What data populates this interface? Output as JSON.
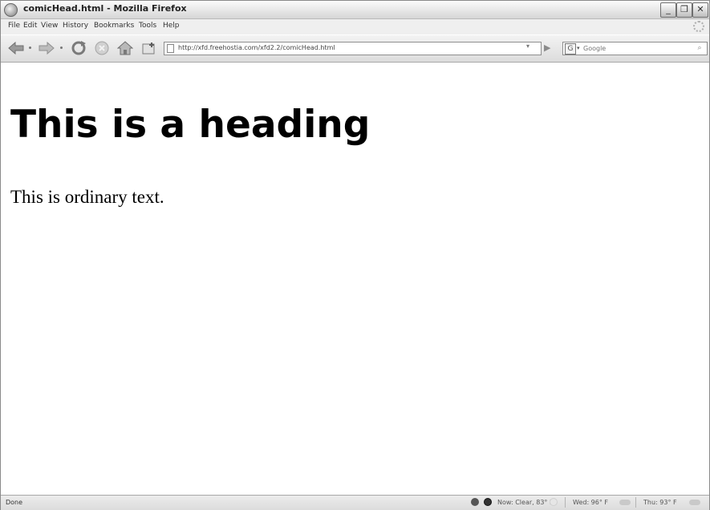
{
  "window": {
    "title": "comicHead.html - Mozilla Firefox",
    "minimize_label": "_",
    "restore_label": "❐",
    "close_label": "✕"
  },
  "menu": [
    "File",
    "Edit",
    "View",
    "History",
    "Bookmarks",
    "Tools",
    "Help"
  ],
  "toolbar": {
    "url": "http://xfd.freehostia.com/xfd2.2/comicHead.html",
    "url_dropdown": "▾",
    "go_label": "▶",
    "search_engine_label": "G",
    "search_engine_drop": "▾",
    "search_placeholder": "Google",
    "search_button": "⌕"
  },
  "page": {
    "heading": "This is a heading",
    "paragraph": "This is ordinary text."
  },
  "status": {
    "text": "Done",
    "now": "Now: Clear, 83° F",
    "wed": "Wed: 96° F",
    "thu": "Thu: 93° F"
  },
  "colors": {
    "accent": "#000000",
    "chrome": "#dcdcdc"
  },
  "icons": [
    "back-icon",
    "forward-icon",
    "reload-icon",
    "stop-icon",
    "home-icon",
    "new-tab-icon",
    "page-icon",
    "search-engine-icon"
  ]
}
